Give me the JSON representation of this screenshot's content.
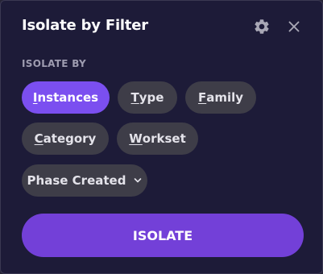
{
  "panel": {
    "title": "Isolate by Filter",
    "icons": {
      "settings": "gear-icon",
      "close": "close-icon"
    }
  },
  "isolate_by": {
    "label": "ISOLATE BY",
    "options": [
      {
        "mnemonic": "I",
        "rest": "nstances",
        "selected": true
      },
      {
        "mnemonic": "T",
        "rest": "ype",
        "selected": false
      },
      {
        "mnemonic": "F",
        "rest": "amily",
        "selected": false
      },
      {
        "mnemonic": "C",
        "rest": "ategory",
        "selected": false
      },
      {
        "mnemonic": "W",
        "rest": "orkset",
        "selected": false
      }
    ],
    "dropdown": {
      "value": "Phase Created",
      "icon": "chevron-down-icon"
    }
  },
  "action": {
    "label": "ISOLATE"
  },
  "colors": {
    "background": "#1d1b38",
    "accent": "#7b4ff0",
    "button": "#7340d8",
    "chip": "#3e3d48"
  }
}
